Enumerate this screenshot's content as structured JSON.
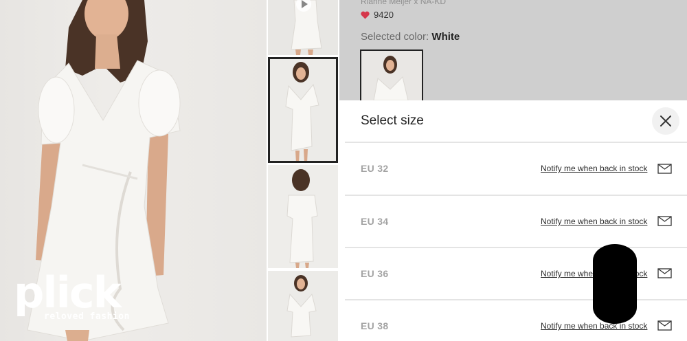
{
  "brand": {
    "logo_text": "plick",
    "tagline": "reloved fashion"
  },
  "gallery": {
    "thumbnails": [
      {
        "label": "thumbnail-1",
        "video": true,
        "selected": false
      },
      {
        "label": "thumbnail-2",
        "video": false,
        "selected": true
      },
      {
        "label": "thumbnail-3",
        "video": false,
        "selected": false
      },
      {
        "label": "thumbnail-4",
        "video": false,
        "selected": false
      }
    ]
  },
  "product": {
    "brand_line": "Rianne Meijer x NA-KD",
    "likes": "9420",
    "selected_color_label": "Selected color:",
    "selected_color_value": "White"
  },
  "size_sheet": {
    "title": "Select size",
    "sizes": [
      {
        "label": "EU 32",
        "notify": "Notify me when back in stock"
      },
      {
        "label": "EU 34",
        "notify": "Notify me when back in stock"
      },
      {
        "label": "EU 36",
        "notify": "Notify me when back in stock"
      },
      {
        "label": "EU 38",
        "notify": "Notify me when back in stock"
      }
    ]
  },
  "colors": {
    "heart": "#d5374b",
    "info_background": "#cfcfcf",
    "divider": "#e4e4e4",
    "redaction": "#000000"
  }
}
